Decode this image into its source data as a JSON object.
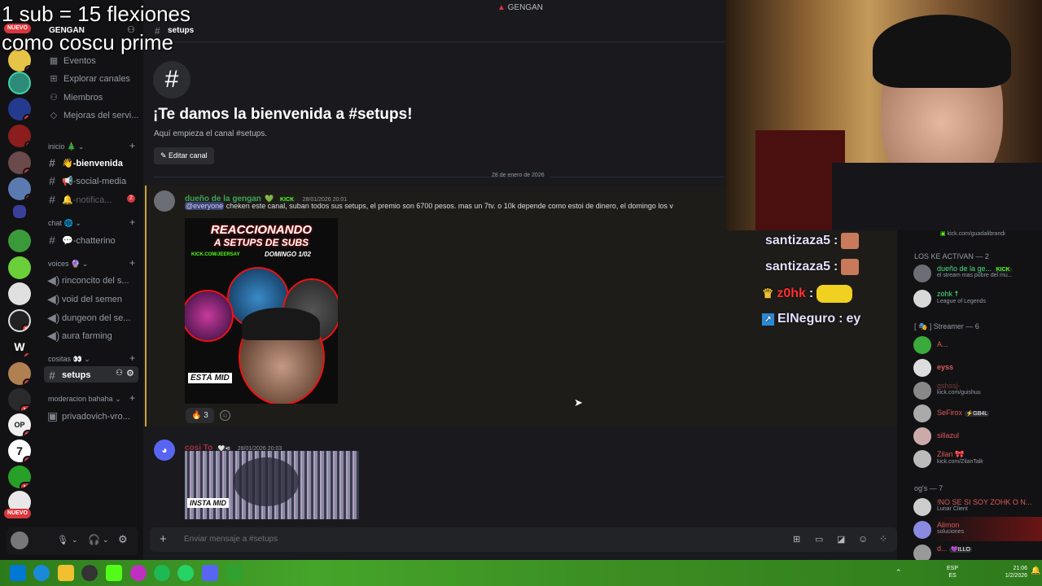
{
  "stream_overlay": {
    "line1": "1 sub = 15 flexiones",
    "line2": "como coscu prime"
  },
  "window_title": "GENGAN",
  "server": {
    "name": "GENGAN"
  },
  "rail": {
    "nuevo_top": "NUEVO",
    "nuevo_bottom": "NUEVO",
    "badges": [
      "1",
      "20",
      "2",
      "46",
      "2",
      "56",
      "37",
      "22",
      "100",
      "72",
      "16",
      "149"
    ]
  },
  "sidebar": {
    "top_items": [
      {
        "label": "Eventos",
        "icon": "calendar-icon"
      },
      {
        "label": "Explorar canales",
        "icon": "browse-icon"
      },
      {
        "label": "Miembros",
        "icon": "members-icon"
      },
      {
        "label": "Mejoras del servi...",
        "icon": "boost-icon"
      }
    ],
    "categories": {
      "inicio": "inicio 🎄",
      "chat": "chat 🌐",
      "voices": "voices 🔮",
      "cositas": "cositas 👀",
      "moderacion": "moderacion bahaha"
    },
    "channels": {
      "bienvenida": "👋-bienvenida",
      "social": "📢-social-media",
      "notifica": "🔔-notifica...",
      "notifica_badge": "2",
      "chatterino": "💬-chatterino",
      "rinconcito": "rinconcito del s...",
      "void": "void del semen",
      "dungeon": "dungeon del se...",
      "aura": "aura farming",
      "setups": "setups",
      "privadovich": "privadovich-vro..."
    }
  },
  "channel_header": {
    "name": "setups"
  },
  "welcome": {
    "title": "¡Te damos la bienvenida a #setups!",
    "subtitle": "Aquí empieza el canal #setups.",
    "edit_button": "Editar canal"
  },
  "date_divider": "28 de enero de 2026",
  "messages": [
    {
      "author": "dueño de la gengan",
      "badge": "KICK",
      "time": "28/01/2026 20:01",
      "mention": "@everyone",
      "text": "cheken este canal, suban todos sus setups, el premio son 6700 pesos. mas un 7tv. o 10k depende como estoi de dinero, el domingo los v",
      "image": {
        "line1": "REACCIONANDO",
        "line2": "A SETUPS DE SUBS",
        "line3": "DOMINGO 1/02",
        "kick": "KICK.COM/JEERSAY",
        "sticker": "ESTÁ MID"
      },
      "reaction": {
        "emoji": "🔥",
        "count": "3"
      }
    },
    {
      "author": "cosi To",
      "time": "28/01/2026 20:03",
      "image_caption": "INSTA MID"
    }
  ],
  "chat_overlay": [
    {
      "user": "santizaza5",
      "sep": ":"
    },
    {
      "user": "santizaza5",
      "sep": ":"
    },
    {
      "user": "z0hk",
      "sep": ":"
    },
    {
      "user": "ElNeguro",
      "sep": ":",
      "text": "ey"
    }
  ],
  "members": {
    "top_status": "kick.com/guadalibrandi",
    "groups": [
      {
        "title": "LOS KE ACTIVAN — 2"
      },
      {
        "title": "[ 🎭 ] Streamer — 6"
      },
      {
        "title": "og's — 7"
      }
    ],
    "items": [
      {
        "name": "dueño de la ge...",
        "tag": "KICK",
        "status": "el stream mas pobre del mu...",
        "color": "#4ade80"
      },
      {
        "name": "zohk ☨",
        "status": "League of Legends",
        "color": "#4ade80"
      },
      {
        "name": "A...",
        "status": "",
        "color": "#e05a5a"
      },
      {
        "name": "eyss",
        "status": "",
        "color": "#e05a5a"
      },
      {
        "name": "gshssj-",
        "status": "kick.com/guishuu",
        "color": "#7a3a3a"
      },
      {
        "name": "SeFirox",
        "tag": "⚡GB4L",
        "status": "",
        "color": "#e05a5a"
      },
      {
        "name": "sillazul",
        "status": "",
        "color": "#e05a5a"
      },
      {
        "name": "Zilan 🎀",
        "status": "kick.com/ZilanTalk",
        "color": "#e05a5a"
      },
      {
        "name": "!NO SE SI SOY ZOHK O N...",
        "status": "Lunar Client",
        "color": "#e05a5a"
      },
      {
        "name": "Alimon",
        "status": "soluciones",
        "color": "#e05a5a"
      },
      {
        "name": "d...",
        "tag": "💜ILLO",
        "status": "",
        "color": "#e05a5a"
      }
    ]
  },
  "composer": {
    "placeholder": "Enviar mensaje a #setups"
  },
  "taskbar": {
    "lang": "ESP",
    "lang2": "ES",
    "time": "21:06",
    "date": "1/2/2026"
  }
}
